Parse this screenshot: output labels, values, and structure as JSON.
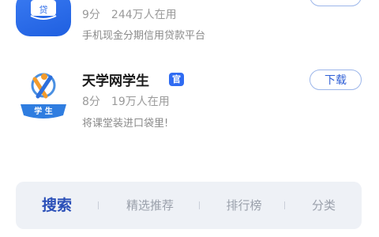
{
  "apps": [
    {
      "meta_score": "9分",
      "meta_users": "244万人在用",
      "description": "手机现金分期信用贷款平台",
      "icon": "graduation-cap-loan-icon",
      "icon_label": "贷"
    },
    {
      "name": "天学网学生",
      "badge": "官",
      "meta_score": "8分",
      "meta_users": "19万人在用",
      "description": "将课堂装进口袋里!",
      "download_label": "下载",
      "icon": "tianxue-student-icon",
      "icon_label": "学 生"
    }
  ],
  "tabs": [
    {
      "label": "搜索",
      "active": true
    },
    {
      "label": "精选推荐",
      "active": false
    },
    {
      "label": "排行榜",
      "active": false
    },
    {
      "label": "分类",
      "active": false
    }
  ],
  "colors": {
    "accent": "#2f6bf2",
    "tab_active": "#2a4fb8",
    "tabbar_bg": "#eef1f6"
  }
}
